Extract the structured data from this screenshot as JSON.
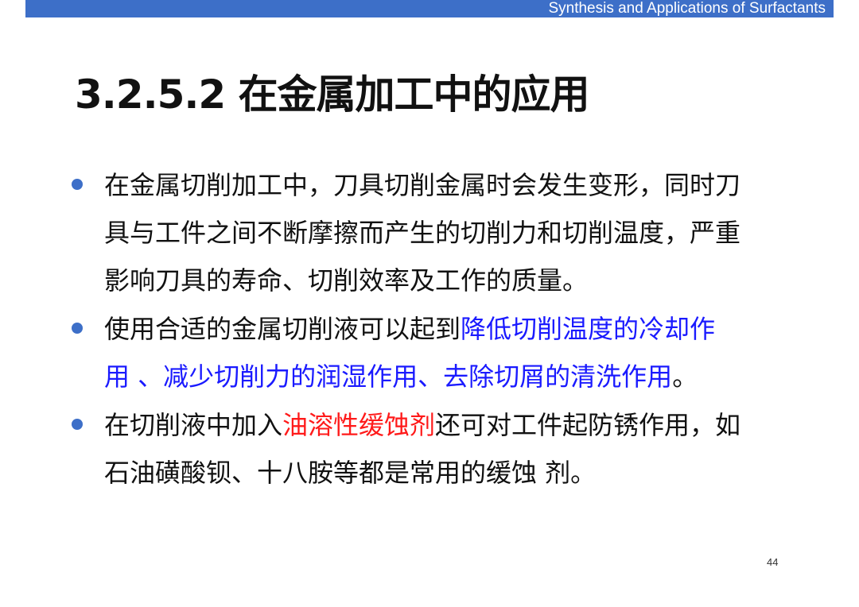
{
  "header": {
    "course": "Synthesis and Applications of Surfactants"
  },
  "slide": {
    "title": "3.2.5.2 在金属加工中的应用",
    "page_number": "44"
  },
  "bullets": [
    {
      "lines": [
        [
          {
            "text": "在金属切削加工中，刀具切削金属时会发生变形，同时刀",
            "style": "normal"
          }
        ],
        [
          {
            "text": "具与工件之间不断摩擦而产生的切削力和切削温度，严重",
            "style": "normal"
          }
        ],
        [
          {
            "text": "影响刀具的寿命、切削效率及工作的质量。",
            "style": "normal"
          }
        ]
      ]
    },
    {
      "lines": [
        [
          {
            "text": "使用合适的金属切削液可以起到",
            "style": "normal"
          },
          {
            "text": "降低切削温度的冷却作",
            "style": "blue"
          }
        ],
        [
          {
            "text": "用 、减少切削力的润湿作用、去除切屑的清洗作用",
            "style": "blue"
          },
          {
            "text": "。",
            "style": "normal"
          }
        ]
      ]
    },
    {
      "lines": [
        [
          {
            "text": "在切削液中加入",
            "style": "normal"
          },
          {
            "text": "油溶性缓蚀剂",
            "style": "red"
          },
          {
            "text": "还可对工件起防锈作用，如",
            "style": "normal"
          }
        ],
        [
          {
            "text": "石油磺酸钡、十八胺等都是常用的缓蚀 剂。",
            "style": "normal"
          }
        ]
      ]
    }
  ],
  "colors": {
    "header_bar": "#3d6fc8",
    "bullet_dot": "#3d6fc8",
    "highlight_blue": "#1a1aff",
    "highlight_red": "#ff1a1a",
    "body_text": "#111111"
  }
}
